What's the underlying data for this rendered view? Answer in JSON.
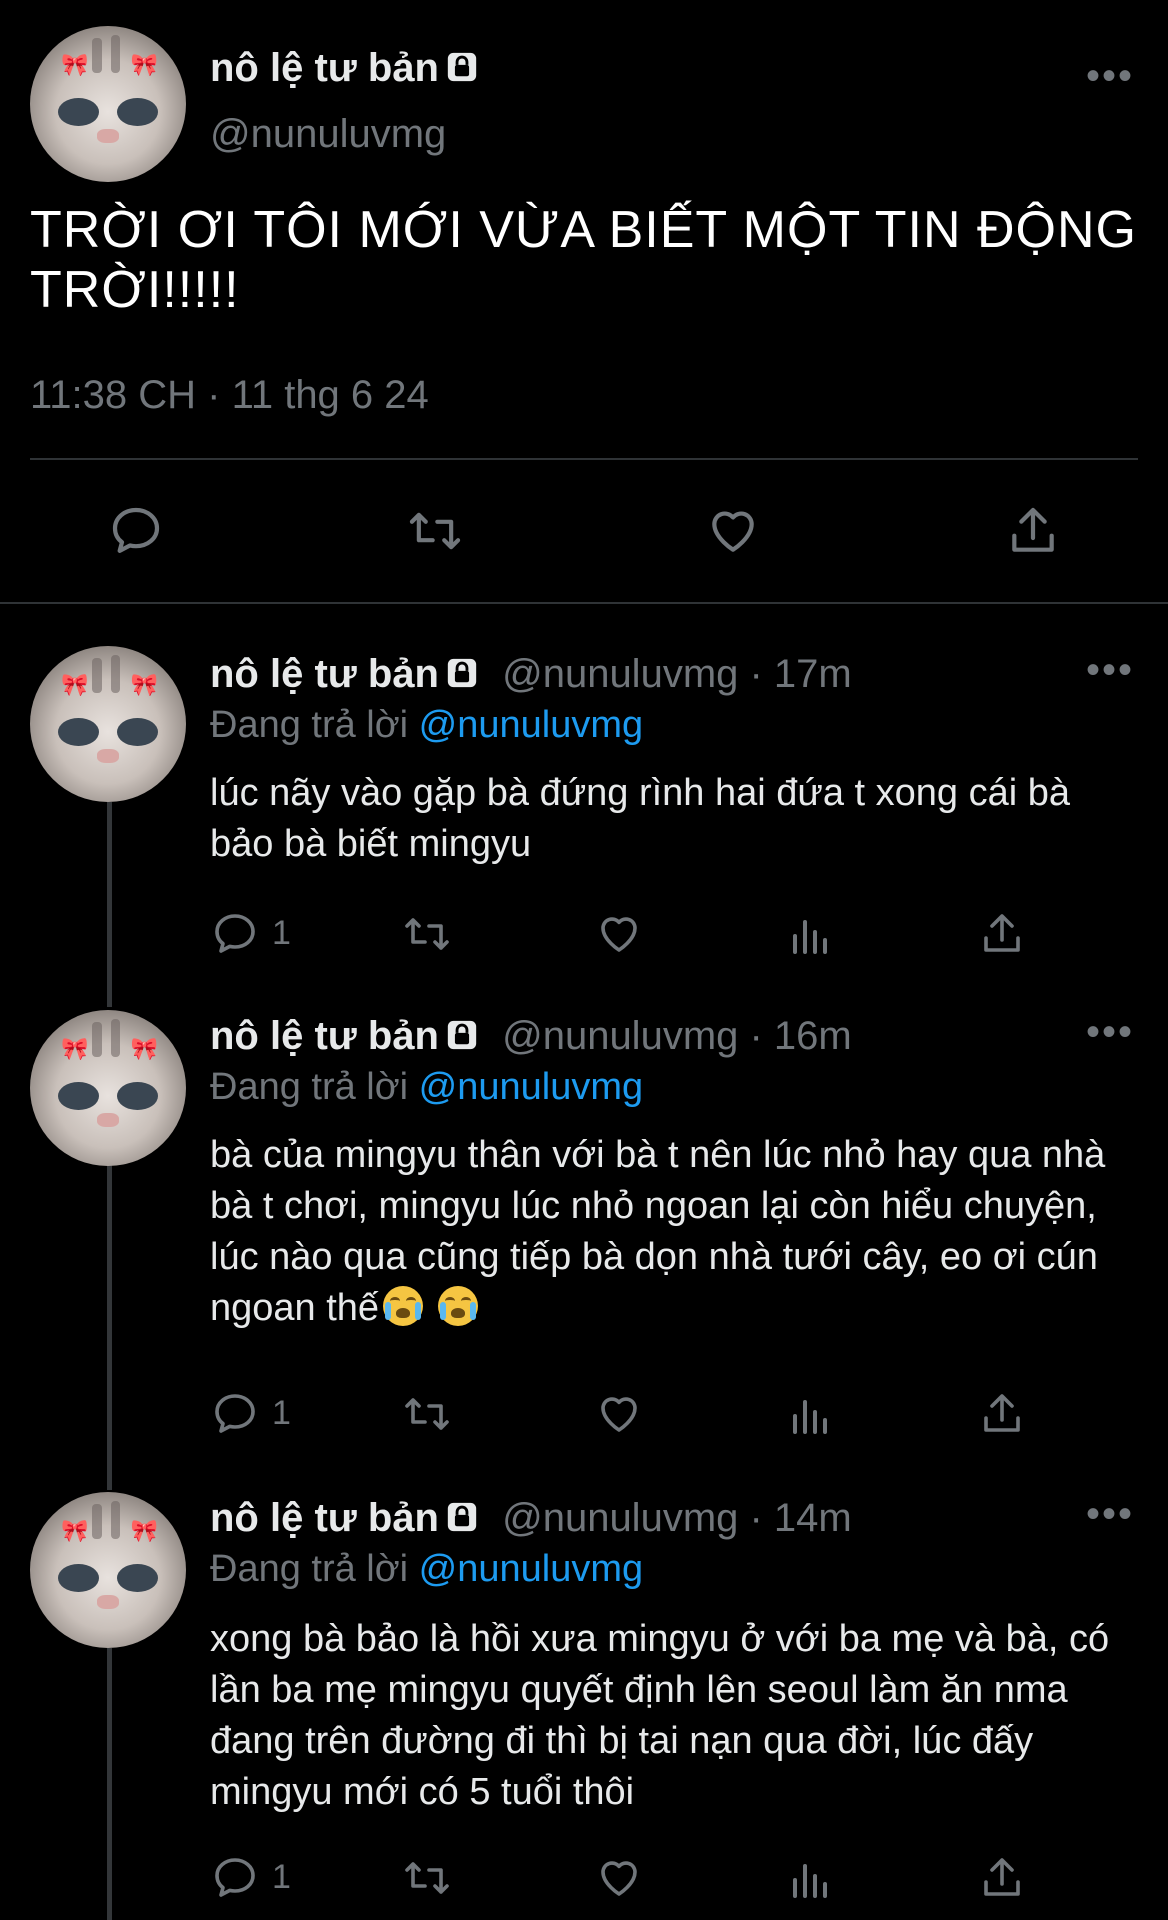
{
  "main_tweet": {
    "display_name": "nô lệ tư bản",
    "handle": "@nunuluvmg",
    "text": "TRỜI ƠI TÔI MỚI VỪA BIẾT MỘT TIN ĐỘNG TRỜI!!!!!",
    "timestamp": "11:38 CH · 11 thg 6 24"
  },
  "replies": [
    {
      "display_name": "nô lệ tư bản",
      "handle_time": "@nunuluvmg · 17m",
      "replying_prefix": "Đang trả lời ",
      "replying_to": "@nunuluvmg",
      "text": "lúc nãy vào gặp bà đứng rình hai đứa t xong cái bà bảo bà biết mingyu",
      "reply_count": "1"
    },
    {
      "display_name": "nô lệ tư bản",
      "handle_time": "@nunuluvmg · 16m",
      "replying_prefix": "Đang trả lời ",
      "replying_to": "@nunuluvmg",
      "text": "bà của mingyu thân với bà t nên lúc nhỏ hay qua nhà bà t chơi, mingyu lúc nhỏ ngoan lại còn hiểu chuyện, lúc nào qua cũng tiếp bà dọn nhà tưới cây, eo ơi cún ngoan thế",
      "reply_count": "1"
    },
    {
      "display_name": "nô lệ tư bản",
      "handle_time": "@nunuluvmg · 14m",
      "replying_prefix": "Đang trả lời ",
      "replying_to": "@nunuluvmg",
      "text": "xong bà bảo là hồi xưa mingyu ở với ba mẹ và bà, có lần ba mẹ mingyu quyết định lên seoul làm ăn nma đang trên đường đi thì bị tai nạn qua đời, lúc đấy mingyu mới có 5 tuổi thôi",
      "reply_count": "1"
    }
  ],
  "icons": {
    "lock": "lock-icon",
    "more": "more-icon",
    "reply": "reply-icon",
    "retweet": "retweet-icon",
    "like": "heart-icon",
    "views": "views-icon",
    "share": "share-icon",
    "emoji": "crying-face-emoji"
  },
  "colors": {
    "background": "#000000",
    "text": "#e7e9ea",
    "muted": "#71767b",
    "mention": "#1d9bf0",
    "divider": "#2f3336"
  }
}
